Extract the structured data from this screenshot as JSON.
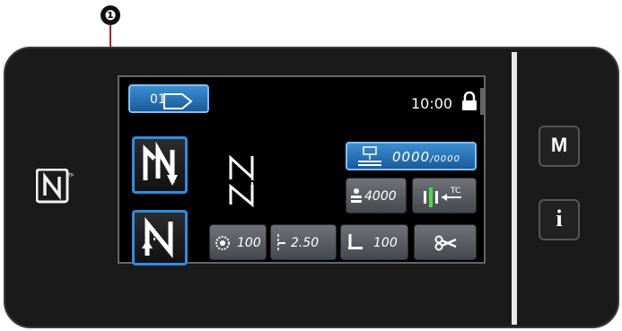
{
  "callout": {
    "number": "❶"
  },
  "side_buttons": {
    "mode": "M",
    "info": "i"
  },
  "screen": {
    "program_number": "01",
    "clock": "10:00",
    "counter": {
      "value": "0000",
      "total": "/0000"
    },
    "bobbin_count": "4000",
    "bottom": {
      "tension": "100",
      "pitch": "2.50",
      "presser_pressure": "100"
    }
  },
  "colors": {
    "screen_bg": "#000000",
    "button_blue": "#2d8de0",
    "panel": "#1a1a1a"
  }
}
